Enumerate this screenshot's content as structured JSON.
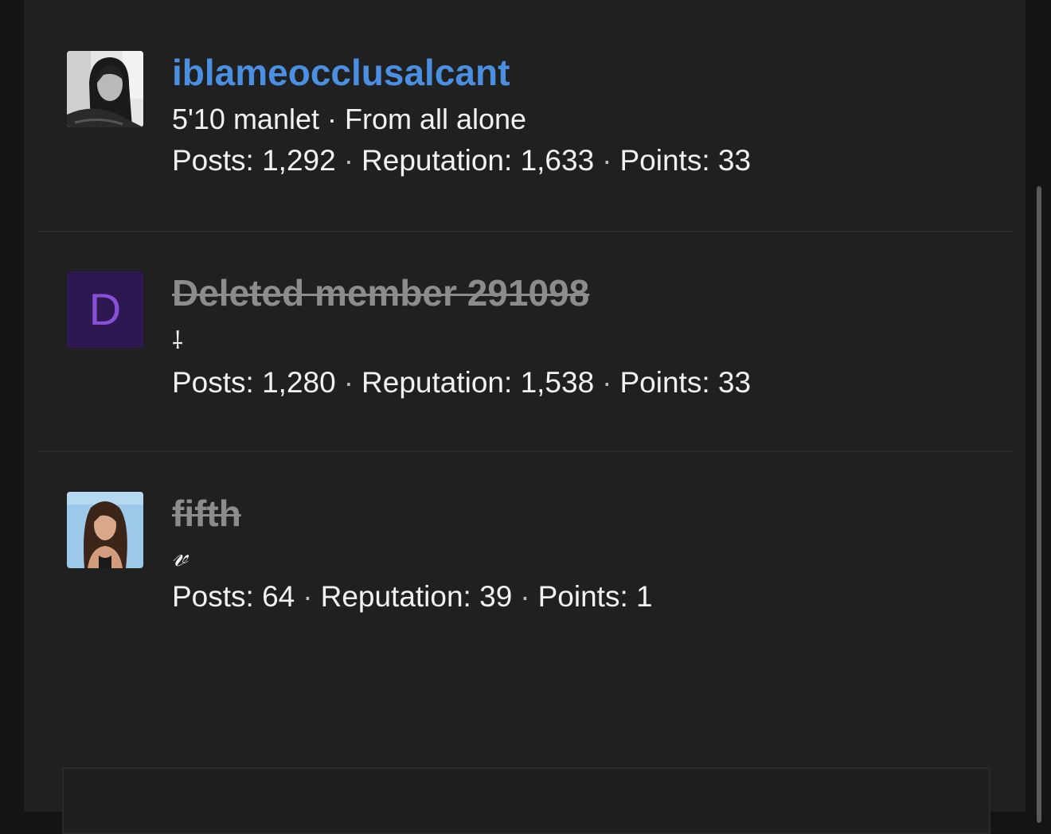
{
  "members": [
    {
      "username": "iblameocclusalcant",
      "tagline": "5'10 manlet · From all alone",
      "posts_label": "Posts:",
      "posts": "1,292",
      "reputation_label": "Reputation:",
      "reputation": "1,633",
      "points_label": "Points:",
      "points": "33",
      "deleted": false
    },
    {
      "username": "Deleted member 291098",
      "avatar_letter": "D",
      "tagline": "⸸",
      "posts_label": "Posts:",
      "posts": "1,280",
      "reputation_label": "Reputation:",
      "reputation": "1,538",
      "points_label": "Points:",
      "points": "33",
      "deleted": true
    },
    {
      "username": "fifth",
      "tagline": "𝓋",
      "posts_label": "Posts:",
      "posts": "64",
      "reputation_label": "Reputation:",
      "reputation": "39",
      "points_label": "Points:",
      "points": "1",
      "deleted": true
    }
  ],
  "separator": "·",
  "colors": {
    "link": "#4a8fe2",
    "deleted_name": "#8c8c8c",
    "avatar_letter_bg": "#2d1852",
    "avatar_letter_fg": "#8a4fd9"
  }
}
